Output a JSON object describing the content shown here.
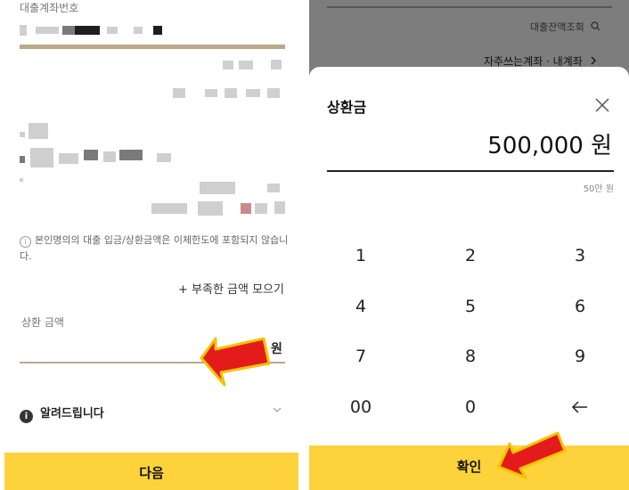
{
  "left": {
    "account_label": "대출계좌번호",
    "notice_icon": "info-icon",
    "notice_text": "본인명의의 대출 입금/상환금액은 이체한도에 포함되지 않습니다.",
    "collect_link": "+ 부족한 금액 모으기",
    "repay_amount_label": "상환 금액",
    "currency_unit": "원",
    "notify_title": "알려드립니다",
    "notify_icon": "info-filled-icon",
    "next_button": "다음"
  },
  "right": {
    "background": {
      "inquiry": "대출잔액조회",
      "accounts": "자주쓰는계좌 · 내계좌"
    },
    "sheet": {
      "title": "상환금",
      "amount_value": "500,000 원",
      "amount_hint": "50만 원",
      "keypad": [
        "1",
        "2",
        "3",
        "4",
        "5",
        "6",
        "7",
        "8",
        "9",
        "00",
        "0",
        "←"
      ],
      "confirm_button": "확인"
    }
  },
  "colors": {
    "accent_yellow": "#fdd23a",
    "underline_gold": "#b9a98a",
    "arrow_red": "#e31b1b",
    "arrow_outline": "#f2c300"
  }
}
